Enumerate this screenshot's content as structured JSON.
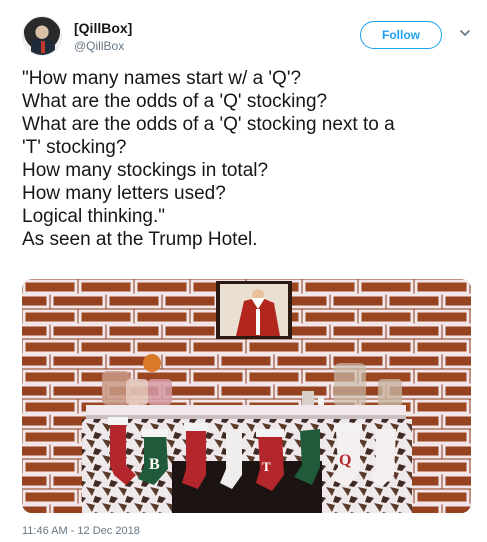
{
  "user": {
    "display_name": "[QillBox]",
    "handle": "@QillBox",
    "avatar_icon": "profile-photo-icon"
  },
  "actions": {
    "follow_label": "Follow",
    "menu_icon": "chevron-down-icon"
  },
  "tweet": {
    "lines": [
      "\"How many names start w/ a 'Q'?",
      "What are the odds of a 'Q' stocking?",
      "What are the odds of a 'Q' stocking next to a",
      "'T' stocking?",
      "How many stockings in total?",
      "How many letters used?",
      "Logical thinking.\"",
      "As seen at the Trump Hotel."
    ],
    "timestamp": "11:46 AM - 12 Dec 2018"
  },
  "photo": {
    "stocking_letters": [
      "B",
      "T",
      "Q"
    ]
  },
  "colors": {
    "accent": "#1da1f2",
    "secondary_text": "#657786",
    "primary_text": "#14171a"
  }
}
